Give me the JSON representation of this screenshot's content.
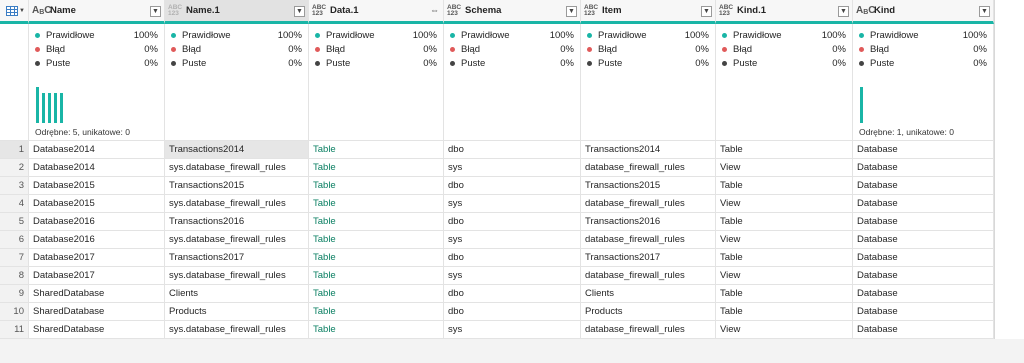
{
  "columns": [
    {
      "name": "Name",
      "type": "ABC"
    },
    {
      "name": "Name.1",
      "type": "ABC123"
    },
    {
      "name": "Data.1",
      "type": "ABC123"
    },
    {
      "name": "Schema",
      "type": "ABC123"
    },
    {
      "name": "Item",
      "type": "ABC123"
    },
    {
      "name": "Kind.1",
      "type": "ABC123"
    },
    {
      "name": "Kind",
      "type": "ABC"
    }
  ],
  "type_icon_top": "ABC",
  "type_icon_bottom": "123",
  "type_icon_abc": "A",
  "type_icon_abc_sub": "B",
  "type_icon_abc_c": "C",
  "quality": {
    "valid_label": "Prawidłowe",
    "valid_value": "100%",
    "error_label": "Błąd",
    "error_value": "0%",
    "empty_label": "Puste",
    "empty_value": "0%"
  },
  "distinct": {
    "name": "Odrębne: 5, unikatowe: 0",
    "kind": "Odrębne: 1, unikatowe: 0"
  },
  "colors": {
    "accent": "#19b5a6",
    "valid": "#19b5a6",
    "error": "#e05a5a",
    "empty": "#444444"
  },
  "rows": [
    {
      "n": "1",
      "c": [
        "Database2014",
        "Transactions2014",
        "Table",
        "dbo",
        "Transactions2014",
        "Table",
        "Database"
      ]
    },
    {
      "n": "2",
      "c": [
        "Database2014",
        "sys.database_firewall_rules",
        "Table",
        "sys",
        "database_firewall_rules",
        "View",
        "Database"
      ]
    },
    {
      "n": "3",
      "c": [
        "Database2015",
        "Transactions2015",
        "Table",
        "dbo",
        "Transactions2015",
        "Table",
        "Database"
      ]
    },
    {
      "n": "4",
      "c": [
        "Database2015",
        "sys.database_firewall_rules",
        "Table",
        "sys",
        "database_firewall_rules",
        "View",
        "Database"
      ]
    },
    {
      "n": "5",
      "c": [
        "Database2016",
        "Transactions2016",
        "Table",
        "dbo",
        "Transactions2016",
        "Table",
        "Database"
      ]
    },
    {
      "n": "6",
      "c": [
        "Database2016",
        "sys.database_firewall_rules",
        "Table",
        "sys",
        "database_firewall_rules",
        "View",
        "Database"
      ]
    },
    {
      "n": "7",
      "c": [
        "Database2017",
        "Transactions2017",
        "Table",
        "dbo",
        "Transactions2017",
        "Table",
        "Database"
      ]
    },
    {
      "n": "8",
      "c": [
        "Database2017",
        "sys.database_firewall_rules",
        "Table",
        "sys",
        "database_firewall_rules",
        "View",
        "Database"
      ]
    },
    {
      "n": "9",
      "c": [
        "SharedDatabase",
        "Clients",
        "Table",
        "dbo",
        "Clients",
        "Table",
        "Database"
      ]
    },
    {
      "n": "10",
      "c": [
        "SharedDatabase",
        "Products",
        "Table",
        "dbo",
        "Products",
        "Table",
        "Database"
      ]
    },
    {
      "n": "11",
      "c": [
        "SharedDatabase",
        "sys.database_firewall_rules",
        "Table",
        "sys",
        "database_firewall_rules",
        "View",
        "Database"
      ]
    }
  ]
}
